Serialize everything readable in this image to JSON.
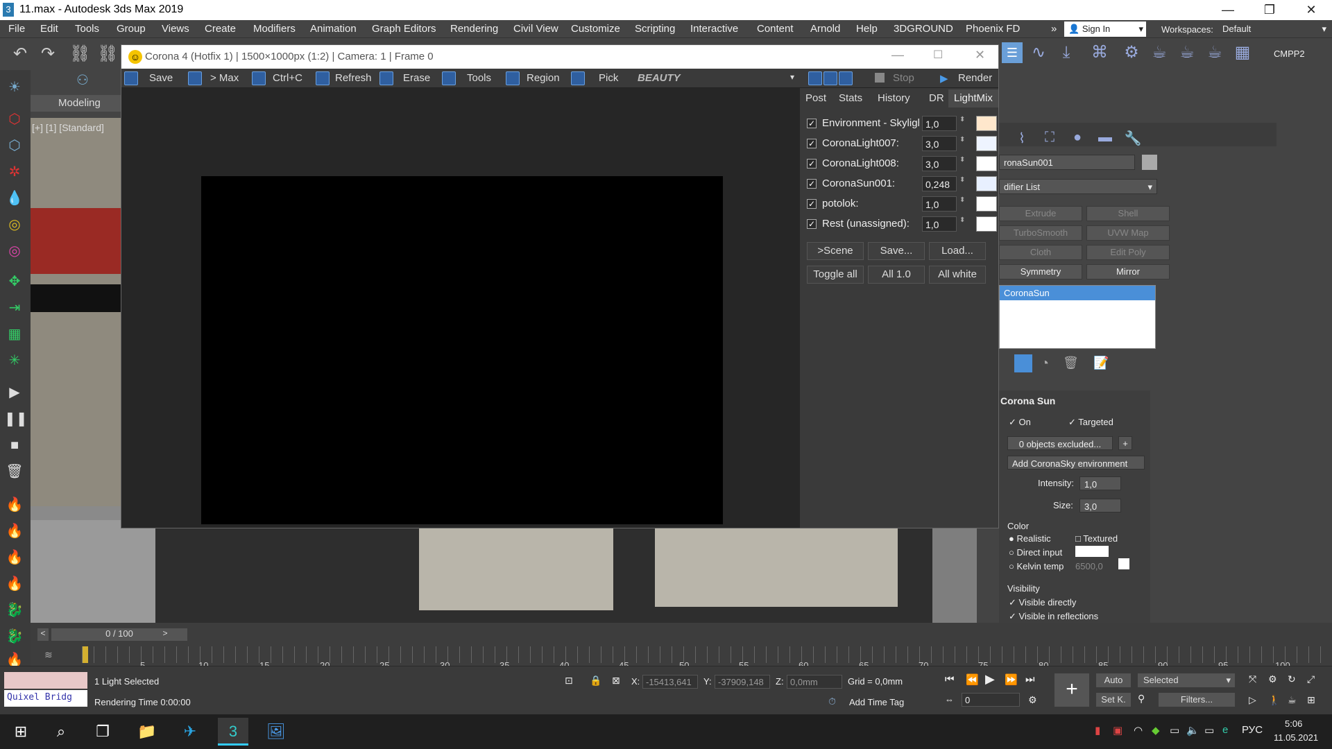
{
  "window": {
    "title": "11.max - Autodesk 3ds Max 2019",
    "app_icon": "3"
  },
  "menu": [
    "File",
    "Edit",
    "Tools",
    "Group",
    "Views",
    "Create",
    "Modifiers",
    "Animation",
    "Graph Editors",
    "Rendering",
    "Civil View",
    "Customize",
    "Scripting",
    "Interactive",
    "Content",
    "Arnold",
    "Help",
    "3DGROUND",
    "Phoenix FD"
  ],
  "account": {
    "sign_in": "Sign In",
    "workspaces_label": "Workspaces:",
    "workspace": "Default",
    "cmpp": "СМРР2"
  },
  "ribbon": {
    "tab": "Modeling"
  },
  "viewport": {
    "label": "[+] [1] [Standard]"
  },
  "vfb": {
    "title": "Corona 4 (Hotfix 1) | 1500×1000px (1:2) | Camera: 1 | Frame 0",
    "toolbar": {
      "save": "Save",
      "to_max": "> Max",
      "copy": "Ctrl+C",
      "refresh": "Refresh",
      "erase": "Erase",
      "tools": "Tools",
      "region": "Region",
      "pick": "Pick",
      "channel": "BEAUTY",
      "stop": "Stop",
      "render": "Render"
    },
    "tabs": [
      "Post",
      "Stats",
      "History",
      "DR",
      "LightMix"
    ],
    "active_tab": "LightMix",
    "lights": [
      {
        "name": "Environment - Skylight",
        "value": "1,0",
        "color": "#ffe7cc"
      },
      {
        "name": "CoronaLight007:",
        "value": "3,0",
        "color": "#eef4ff"
      },
      {
        "name": "CoronaLight008:",
        "value": "3,0",
        "color": "#ffffff"
      },
      {
        "name": "CoronaSun001:",
        "value": "0,248",
        "color": "#e8f0ff"
      },
      {
        "name": "potolok:",
        "value": "1,0",
        "color": "#ffffff"
      },
      {
        "name": "Rest (unassigned):",
        "value": "1,0",
        "color": "#ffffff"
      }
    ],
    "buttons": {
      "scene": ">Scene",
      "save": "Save...",
      "load": "Load...",
      "toggle_all": "Toggle all",
      "all_1": "All 1.0",
      "all_white": "All white"
    }
  },
  "cmd": {
    "object_name": "ronaSun001",
    "modifier_list": "difier List",
    "mod_buttons": [
      "Extrude",
      "Shell",
      "TurboSmooth",
      "UVW Map",
      "Cloth",
      "Edit Poly",
      "Symmetry",
      "Mirror"
    ],
    "stack_item": "CoronaSun",
    "rollout_title": "Corona Sun",
    "on": "On",
    "targeted": "Targeted",
    "excluded": "0 objects excluded...",
    "plus": "+",
    "add_sky": "Add CoronaSky environment",
    "intensity_label": "Intensity:",
    "intensity": "1,0",
    "size_label": "Size:",
    "size": "3,0",
    "color_label": "Color",
    "realistic": "Realistic",
    "textured": "Textured",
    "direct_input": "Direct input",
    "kelvin": "Kelvin temp",
    "kelvin_val": "6500,0",
    "visibility": "Visibility",
    "vis_direct": "Visible directly",
    "vis_refl": "Visible in reflections"
  },
  "timeline": {
    "frame": "0 / 100",
    "ticks": [
      "5",
      "10",
      "15",
      "20",
      "25",
      "30",
      "35",
      "40",
      "45",
      "50",
      "55",
      "60",
      "65",
      "70",
      "75",
      "80",
      "85",
      "90",
      "95",
      "100"
    ]
  },
  "status": {
    "quixel": "Quixel Bridg",
    "selected": "1 Light Selected",
    "render_time": "Rendering Time  0:00:00",
    "x_label": "X:",
    "x": "-15413,641",
    "y_label": "Y:",
    "y": "-37909,148",
    "z_label": "Z:",
    "z": "0,0mm",
    "grid": "Grid = 0,0mm",
    "add_time_tag": "Add Time Tag",
    "auto": "Auto",
    "selected_dd": "Selected",
    "setk": "Set K.",
    "filters": "Filters...",
    "frame_field": "0"
  },
  "taskbar": {
    "lang": "РУС",
    "time": "5:06",
    "date": "11.05.2021"
  }
}
